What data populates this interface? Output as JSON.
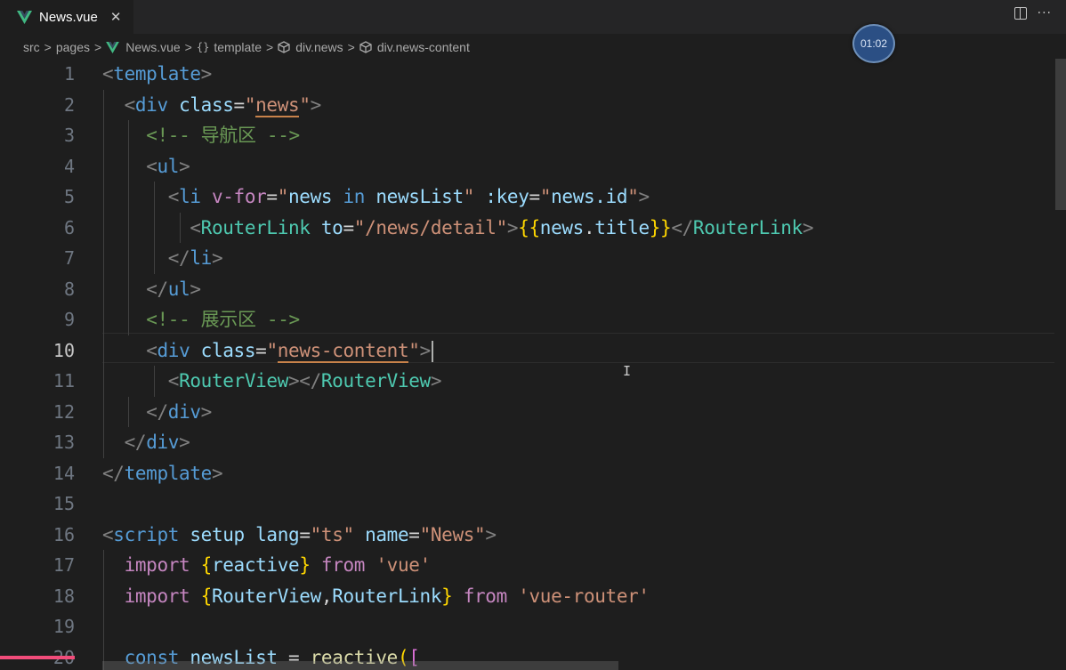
{
  "tab": {
    "label": "News.vue",
    "close": "✕",
    "icon": "vue-icon"
  },
  "tab_actions": {
    "split": "split-editor-icon",
    "more": "···"
  },
  "breadcrumb": {
    "items": [
      "src",
      "pages",
      "News.vue",
      "template",
      "div.news",
      "div.news-content"
    ],
    "separator": ">",
    "braces": "{}"
  },
  "timer": "01:02",
  "editor": {
    "active_line": 10,
    "line_numbers": [
      "1",
      "2",
      "3",
      "4",
      "5",
      "6",
      "7",
      "8",
      "9",
      "10",
      "11",
      "12",
      "13",
      "14",
      "15",
      "16",
      "17",
      "18",
      "19",
      "20"
    ]
  },
  "code": {
    "l1": {
      "open": "<",
      "tag": "template",
      "close": ">"
    },
    "l2": {
      "open": "<",
      "tag": "div",
      "attr": "class",
      "eq": "=",
      "q1": "\"",
      "val": "news",
      "q2": "\"",
      "close": ">"
    },
    "l3": {
      "comment": "<!-- 导航区 -->"
    },
    "l4": {
      "open": "<",
      "tag": "ul",
      "close": ">"
    },
    "l5": {
      "open": "<",
      "tag": "li",
      "attr1": "v-for",
      "eq1": "=",
      "q1": "\"",
      "v1": "news",
      "kw": "in",
      "v2": "newsList",
      "q2": "\"",
      "attr2": ":key",
      "eq2": "=",
      "q3": "\"",
      "v3": "news.id",
      "q4": "\"",
      "close": ">"
    },
    "l6": {
      "open": "<",
      "tag": "RouterLink",
      "attr": "to",
      "eq": "=",
      "val": "\"/news/detail\"",
      "close": ">",
      "lbrace": "{{",
      "expr1": "news",
      "dot": ".",
      "expr2": "title",
      "rbrace": "}}",
      "open2": "</",
      "tag2": "RouterLink",
      "close2": ">"
    },
    "l7": {
      "open": "</",
      "tag": "li",
      "close": ">"
    },
    "l8": {
      "open": "</",
      "tag": "ul",
      "close": ">"
    },
    "l9": {
      "comment": "<!-- 展示区 -->"
    },
    "l10": {
      "open": "<",
      "tag": "div",
      "attr": "class",
      "eq": "=",
      "q1": "\"",
      "val": "news-content",
      "q2": "\"",
      "close": ">"
    },
    "l11": {
      "open": "<",
      "tag": "RouterView",
      "close": ">",
      "open2": "</",
      "tag2": "RouterView",
      "close2": ">"
    },
    "l12": {
      "open": "</",
      "tag": "div",
      "close": ">"
    },
    "l13": {
      "open": "</",
      "tag": "div",
      "close": ">"
    },
    "l14": {
      "open": "</",
      "tag": "template",
      "close": ">"
    },
    "l15": {},
    "l16": {
      "open": "<",
      "tag": "script",
      "attr1": "setup",
      "attr2": "lang",
      "eq1": "=",
      "v1": "\"ts\"",
      "attr3": "name",
      "eq2": "=",
      "v2": "\"News\"",
      "close": ">"
    },
    "l17": {
      "kw": "import",
      "lb": "{",
      "name": "reactive",
      "rb": "}",
      "from": "from",
      "mod": "'vue'"
    },
    "l18": {
      "kw": "import",
      "lb": "{",
      "name1": "RouterView",
      "comma": ",",
      "name2": "RouterLink",
      "rb": "}",
      "from": "from",
      "mod": "'vue-router'"
    },
    "l19": {},
    "l20": {
      "kw": "const",
      "name": "newsList",
      "eq": "=",
      "fn": "reactive",
      "lp": "(",
      "lb": "["
    }
  },
  "colors": {
    "background": "#1e1e1e",
    "tag": "#569cd6",
    "component": "#4ec9b0",
    "attribute": "#9cdcfe",
    "string": "#ce9178",
    "comment": "#6a9955",
    "keyword": "#c586c0",
    "progress": "#f14c7a"
  },
  "scroll": {
    "horizontal_thumb_fraction": 0.54,
    "vertical_thumb_fraction": 0.25
  },
  "progress_fraction": 0.07
}
